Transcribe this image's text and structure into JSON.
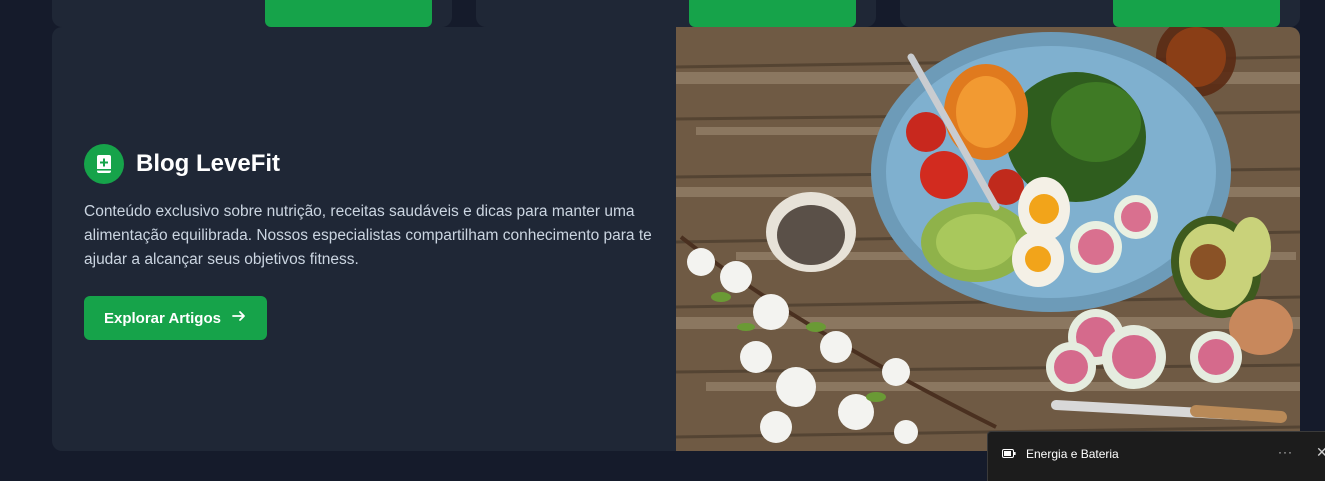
{
  "blog": {
    "title": "Blog LeveFit",
    "description": "Conteúdo exclusivo sobre nutrição, receitas saudáveis e dicas para manter uma alimentação equilibrada. Nossos especialistas compartilham conhecimento para te ajudar a alcançar seus objetivos fitness.",
    "cta_label": "Explorar Artigos",
    "cta_icon": "arrow-right-icon",
    "title_icon": "book-plus-icon",
    "accent": "#16a34a"
  },
  "notification": {
    "title": "Energia e Bateria",
    "more_label": "···",
    "close_label": "✕",
    "icon": "battery-icon"
  }
}
